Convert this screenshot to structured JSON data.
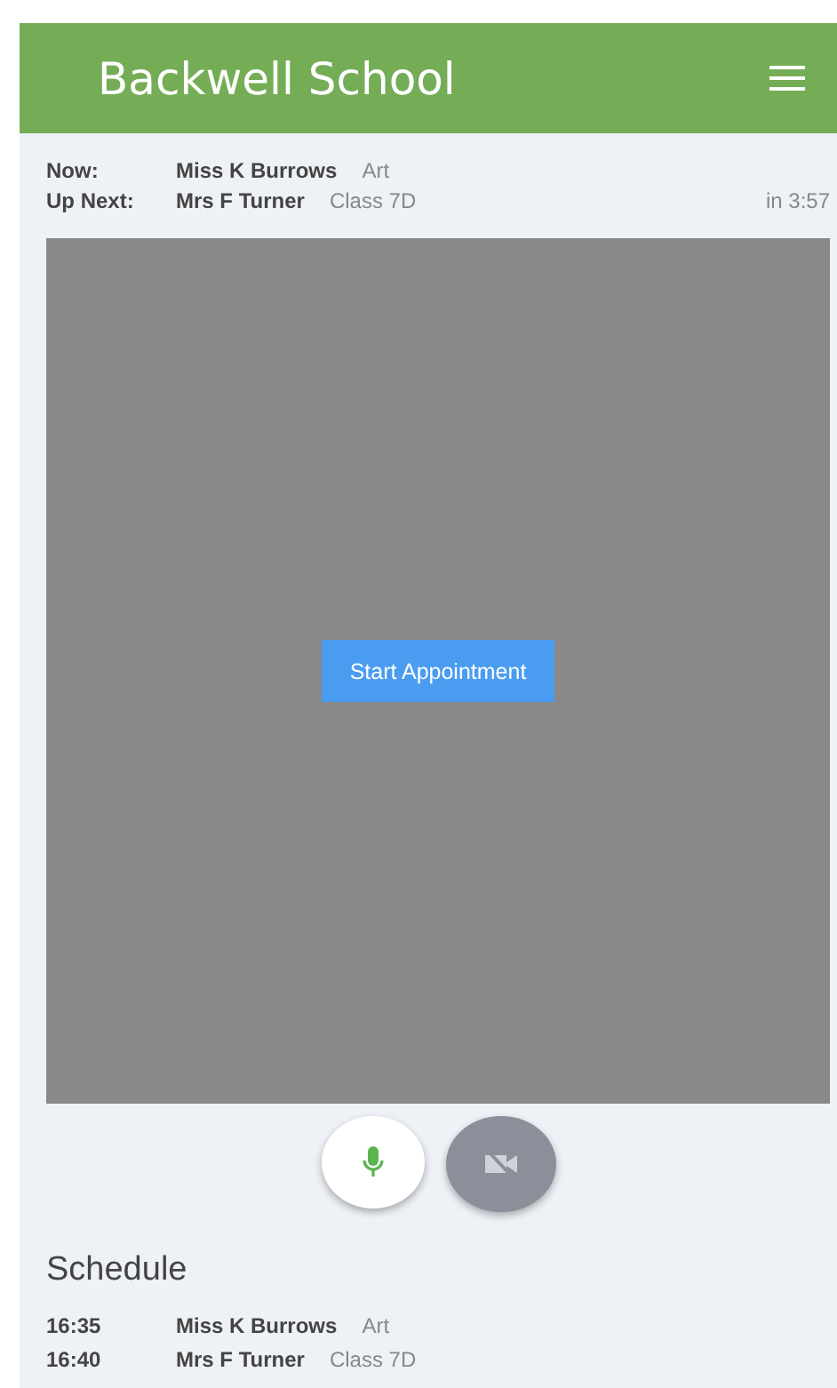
{
  "header": {
    "title": "Backwell School"
  },
  "status": [
    {
      "label": "Now:",
      "name": "Miss K Burrows",
      "detail": "Art"
    },
    {
      "label": "Up Next:",
      "name": "Mrs F Turner",
      "detail": "Class 7D",
      "countdown": "in 3:57"
    }
  ],
  "video": {
    "button": "Start Appointment"
  },
  "controls": {
    "microphone_on": true,
    "camera_on": false
  },
  "schedule": {
    "title": "Schedule",
    "rows": [
      {
        "time": "16:35",
        "name": "Miss K Burrows",
        "detail": "Art"
      },
      {
        "time": "16:40",
        "name": "Mrs F Turner",
        "detail": "Class 7D"
      }
    ]
  }
}
